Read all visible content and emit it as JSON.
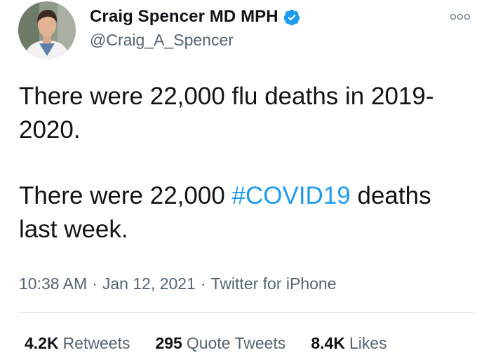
{
  "author": {
    "display_name": "Craig Spencer MD MPH",
    "handle": "@Craig_A_Spencer",
    "verified": true
  },
  "tweet": {
    "line1": "There were 22,000 flu deaths in 2019-2020.",
    "line2_prefix": "There were 22,000 ",
    "hashtag": "#COVID19",
    "line2_suffix": " deaths last week."
  },
  "meta": {
    "time": "10:38 AM",
    "separator": "·",
    "date": "Jan 12, 2021",
    "source": "Twitter for iPhone"
  },
  "stats": {
    "retweets_count": "4.2K",
    "retweets_label": "Retweets",
    "quotes_count": "295",
    "quotes_label": "Quote Tweets",
    "likes_count": "8.4K",
    "likes_label": "Likes"
  },
  "colors": {
    "link": "#1d9bf0",
    "secondary_text": "#536471",
    "verified_badge": "#1d9bf0"
  },
  "icons": [
    "verified-badge-icon",
    "more-options-icon"
  ]
}
